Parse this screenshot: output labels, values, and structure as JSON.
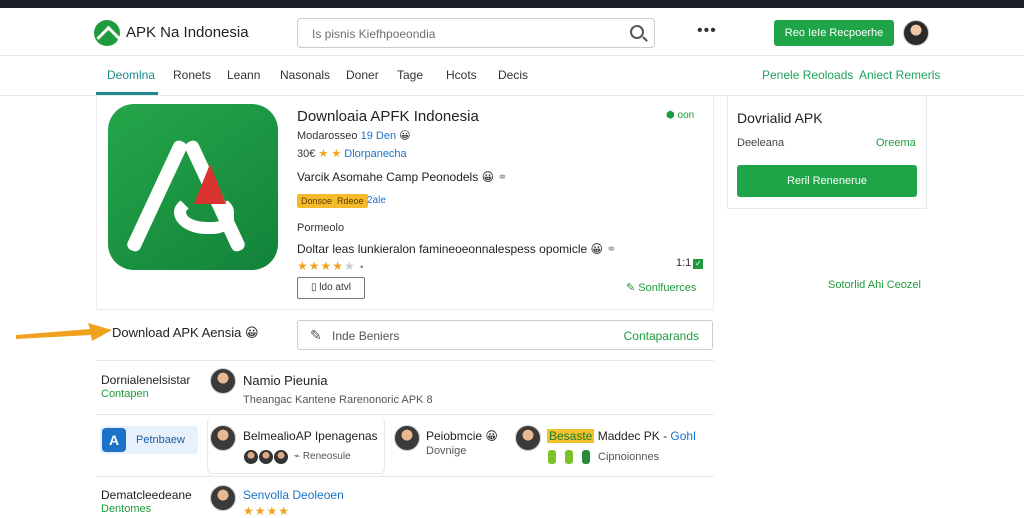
{
  "window": {
    "title": "",
    "center_title": ""
  },
  "header": {
    "brand": "APK Na Indonesia",
    "search_placeholder": "Is pisnis Kiefhpoeondia",
    "more_icon": "more-horizontal-icon",
    "cta_label": "Reo IeIe Recpoerhe"
  },
  "nav": {
    "items": [
      "Deomlna",
      "Ronets",
      "Leann",
      "Nasonals",
      "Doner",
      "Tage",
      "Hcots",
      "Decis"
    ],
    "active_index": 0,
    "right_links": [
      "Penele Reoloads",
      "Aniect Remerls"
    ]
  },
  "app": {
    "title": "Downloaia APFK Indonesia",
    "developer": "Modarosseo",
    "developer_rating": "19 Den",
    "rating_value": "30€",
    "rating_link": "Dlorpanecha",
    "variant": "Varcik Asomahe Camp Peonodels",
    "tags": [
      "Donsoe",
      "Rdeoe"
    ],
    "size": "2ale",
    "description_label": "Pormeolo",
    "description": "Doltar leas lunkieralon famineoeonnalespess opomicle",
    "stars": 4,
    "version": "1:1",
    "badge": "oon",
    "button_label": "ldo atvl",
    "side_link": "Sonlfuerces"
  },
  "download_box": {
    "title": "Dovrialid APK",
    "left_label": "Deeleana",
    "right_label": "Oreema",
    "button_label": "Reril Renenerue",
    "below_link": "Sotorlid Ahi Ceozel"
  },
  "section": {
    "label": "Download APK Aensia",
    "input_placeholder": "Inde Beniers",
    "input_action": "Contaparands"
  },
  "rows": [
    {
      "label": "Dornialenelsistar",
      "sub": "Contapen",
      "name": "Namio Pieunia",
      "detail": "Theangac Kantene Rarenonoric APK 8"
    },
    {
      "tile": "Petnbaew",
      "card": {
        "name": "BelmealioAP Ipenagenas",
        "detail": "Reneosule"
      },
      "col2": {
        "name": "Peiobmcie",
        "detail": "Dovnige"
      },
      "col3": {
        "name": "Besaste",
        "name_suffix": "Maddec PK -",
        "link": "Gohl",
        "detail": "Cipnoionnes"
      }
    },
    {
      "label": "Dematcleedeane",
      "sub": "Dentomes",
      "name": "Senvolla Deoleoen"
    }
  ]
}
